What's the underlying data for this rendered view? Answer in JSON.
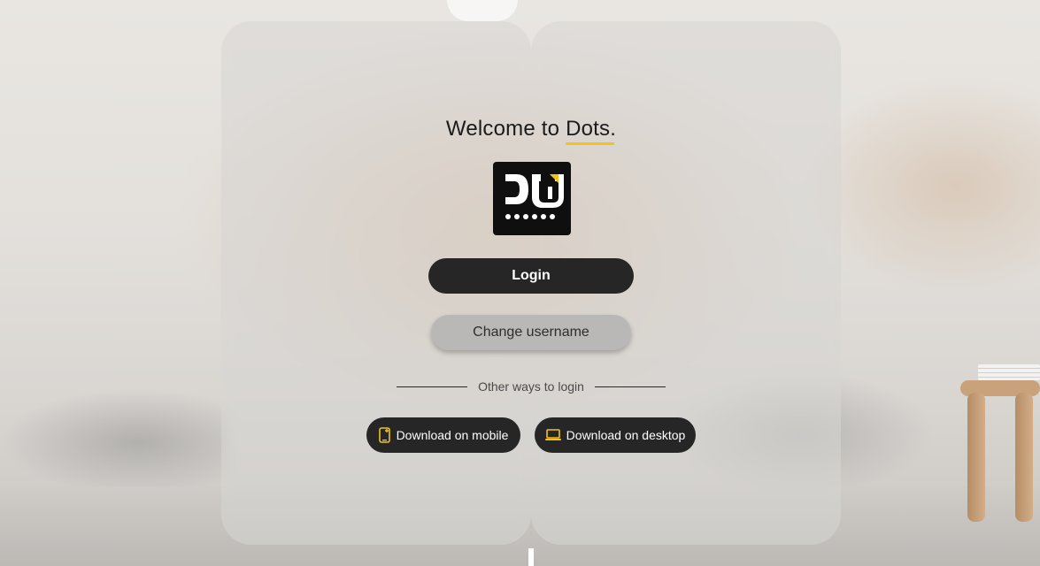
{
  "welcome": {
    "prefix": "Welcome to",
    "brand": "Dots."
  },
  "logo": {
    "icon": "dots-logo-icon"
  },
  "buttons": {
    "login": "Login",
    "change_username": "Change username",
    "download_mobile": "Download on mobile",
    "download_desktop": "Download on desktop"
  },
  "divider": {
    "text": "Other ways to login"
  },
  "icons": {
    "mobile": "mobile-download-icon",
    "desktop": "laptop-icon"
  },
  "colors": {
    "accent": "#f2c21b",
    "button_dark": "#262626",
    "button_secondary": "#b9b8b6"
  }
}
